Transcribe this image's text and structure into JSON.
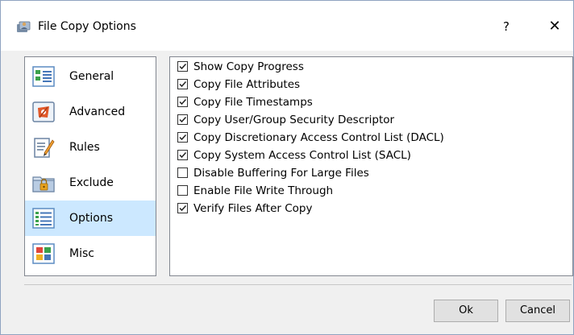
{
  "window": {
    "title": "File Copy Options",
    "help_label": "?",
    "close_label": "✕"
  },
  "sidebar": {
    "items": [
      {
        "label": "General",
        "icon": "general-list-icon"
      },
      {
        "label": "Advanced",
        "icon": "advanced-icon"
      },
      {
        "label": "Rules",
        "icon": "rules-icon"
      },
      {
        "label": "Exclude",
        "icon": "exclude-lock-folder-icon"
      },
      {
        "label": "Options",
        "icon": "options-list-icon",
        "selected": true
      },
      {
        "label": "Misc",
        "icon": "misc-grid-icon"
      }
    ]
  },
  "options": [
    {
      "label": "Show Copy Progress",
      "checked": true
    },
    {
      "label": "Copy File Attributes",
      "checked": true
    },
    {
      "label": "Copy File Timestamps",
      "checked": true
    },
    {
      "label": "Copy User/Group Security Descriptor",
      "checked": true
    },
    {
      "label": "Copy Discretionary Access Control List (DACL)",
      "checked": true
    },
    {
      "label": "Copy System Access Control List (SACL)",
      "checked": true
    },
    {
      "label": "Disable Buffering For Large Files",
      "checked": false
    },
    {
      "label": "Enable File Write Through",
      "checked": false
    },
    {
      "label": "Verify Files After Copy",
      "checked": true
    }
  ],
  "buttons": {
    "ok": "Ok",
    "cancel": "Cancel"
  },
  "colors": {
    "selection": "#cce8ff",
    "border": "#828790"
  }
}
